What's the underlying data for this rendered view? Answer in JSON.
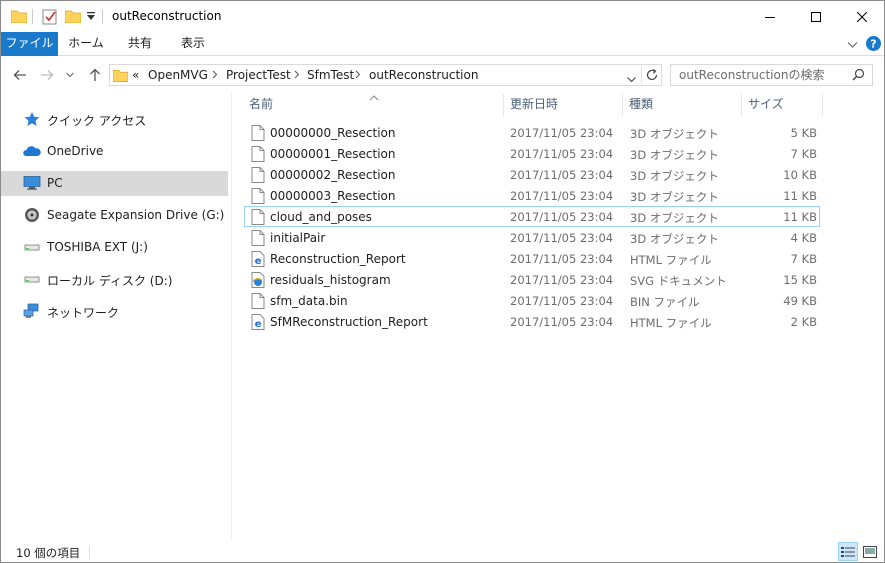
{
  "window": {
    "title": "outReconstruction"
  },
  "ribbon": {
    "tabs": [
      "ファイル",
      "ホーム",
      "共有",
      "表示"
    ]
  },
  "address": {
    "overflow": "«",
    "crumbs": [
      "OpenMVG",
      "ProjectTest",
      "SfmTest",
      "outReconstruction"
    ]
  },
  "search": {
    "placeholder": "outReconstructionの検索"
  },
  "sidebar": {
    "items": [
      {
        "label": "クイック アクセス",
        "icon": "quick-access-star-icon",
        "selected": false
      },
      {
        "label": "OneDrive",
        "icon": "onedrive-cloud-icon",
        "selected": false
      },
      {
        "label": "PC",
        "icon": "pc-monitor-icon",
        "selected": true
      },
      {
        "label": "Seagate Expansion Drive (G:)",
        "icon": "external-drive-icon",
        "selected": false
      },
      {
        "label": "TOSHIBA EXT (J:)",
        "icon": "usb-drive-icon",
        "selected": false
      },
      {
        "label": "ローカル ディスク (D:)",
        "icon": "local-disk-icon",
        "selected": false
      },
      {
        "label": "ネットワーク",
        "icon": "network-icon",
        "selected": false
      }
    ]
  },
  "columns": {
    "name": "名前",
    "date": "更新日時",
    "type": "種類",
    "size": "サイズ"
  },
  "files": [
    {
      "name": "00000000_Resection",
      "date": "2017/11/05 23:04",
      "type": "3D オブジェクト",
      "size": "5 KB",
      "icon": "blank-file-icon"
    },
    {
      "name": "00000001_Resection",
      "date": "2017/11/05 23:04",
      "type": "3D オブジェクト",
      "size": "7 KB",
      "icon": "blank-file-icon"
    },
    {
      "name": "00000002_Resection",
      "date": "2017/11/05 23:04",
      "type": "3D オブジェクト",
      "size": "10 KB",
      "icon": "blank-file-icon"
    },
    {
      "name": "00000003_Resection",
      "date": "2017/11/05 23:04",
      "type": "3D オブジェクト",
      "size": "11 KB",
      "icon": "blank-file-icon"
    },
    {
      "name": "cloud_and_poses",
      "date": "2017/11/05 23:04",
      "type": "3D オブジェクト",
      "size": "11 KB",
      "icon": "blank-file-icon",
      "focused": true
    },
    {
      "name": "initialPair",
      "date": "2017/11/05 23:04",
      "type": "3D オブジェクト",
      "size": "4 KB",
      "icon": "blank-file-icon"
    },
    {
      "name": "Reconstruction_Report",
      "date": "2017/11/05 23:04",
      "type": "HTML ファイル",
      "size": "7 KB",
      "icon": "html-file-icon"
    },
    {
      "name": "residuals_histogram",
      "date": "2017/11/05 23:04",
      "type": "SVG ドキュメント",
      "size": "15 KB",
      "icon": "svg-file-icon"
    },
    {
      "name": "sfm_data.bin",
      "date": "2017/11/05 23:04",
      "type": "BIN ファイル",
      "size": "49 KB",
      "icon": "blank-file-icon"
    },
    {
      "name": "SfMReconstruction_Report",
      "date": "2017/11/05 23:04",
      "type": "HTML ファイル",
      "size": "2 KB",
      "icon": "html-file-icon"
    }
  ],
  "status": {
    "item_count": "10 個の項目"
  },
  "colors": {
    "accent": "#1979ca",
    "selected_bg": "#d9d9d9",
    "focus_border": "#99d1ff"
  }
}
